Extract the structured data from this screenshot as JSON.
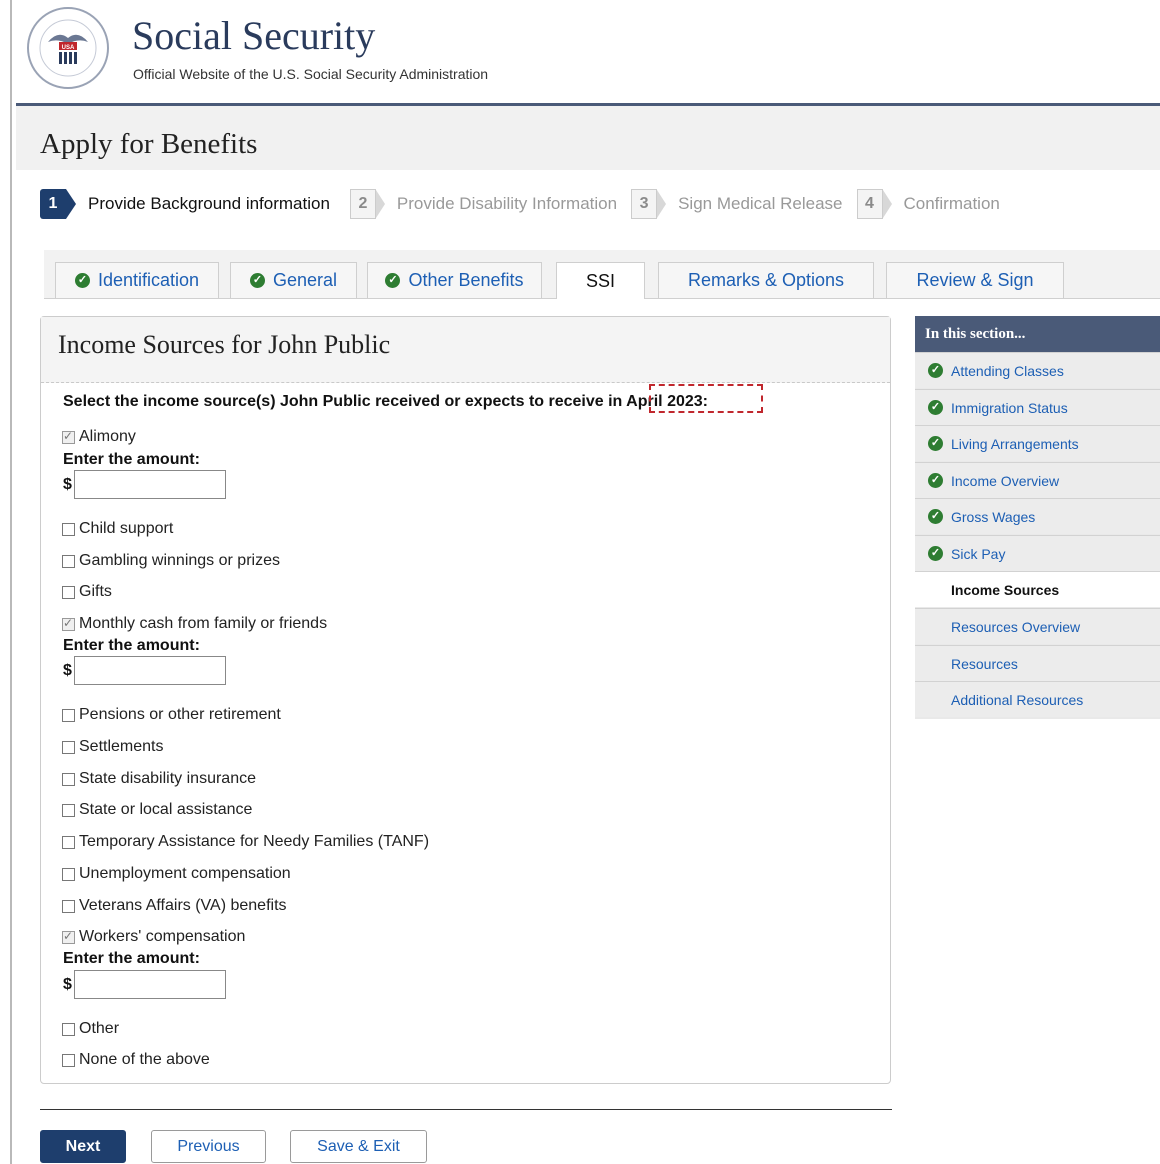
{
  "header": {
    "title": "Social Security",
    "subtitle": "Official Website of the U.S. Social Security Administration",
    "seal_text": "SOCIAL SECURITY ADMINISTRATION USA"
  },
  "page_title": "Apply for Benefits",
  "steps": [
    {
      "num": "1",
      "label": "Provide Background information",
      "active": true
    },
    {
      "num": "2",
      "label": "Provide Disability Information",
      "active": false
    },
    {
      "num": "3",
      "label": "Sign Medical Release",
      "active": false
    },
    {
      "num": "4",
      "label": "Confirmation",
      "active": false
    }
  ],
  "tabs": [
    {
      "label": "Identification",
      "completed": true
    },
    {
      "label": "General",
      "completed": true
    },
    {
      "label": "Other Benefits",
      "completed": true
    },
    {
      "label": "SSI",
      "active": true
    },
    {
      "label": "Remarks & Options"
    },
    {
      "label": "Review & Sign"
    }
  ],
  "form": {
    "title": "Income Sources for John Public",
    "question_main": "Select the income source(s) John Public received or expects to receive i",
    "question_highlight": "n April 2023:",
    "amount_label": "Enter the amount:",
    "currency": "$",
    "options": [
      {
        "label": "Alimony",
        "checked": true
      },
      {
        "label": "Child support",
        "checked": false
      },
      {
        "label": "Gambling winnings or prizes",
        "checked": false
      },
      {
        "label": "Gifts",
        "checked": false
      },
      {
        "label": "Monthly cash from family or friends",
        "checked": true
      },
      {
        "label": "Pensions or other retirement",
        "checked": false
      },
      {
        "label": "Settlements",
        "checked": false
      },
      {
        "label": "State disability insurance",
        "checked": false
      },
      {
        "label": "State or local assistance",
        "checked": false
      },
      {
        "label": "Temporary Assistance for Needy Families (TANF)",
        "checked": false
      },
      {
        "label": "Unemployment compensation",
        "checked": false
      },
      {
        "label": "Veterans Affairs (VA) benefits",
        "checked": false
      },
      {
        "label": "Workers' compensation",
        "checked": true
      },
      {
        "label": "Other",
        "checked": false
      },
      {
        "label": "None of the above",
        "checked": false
      }
    ]
  },
  "sidebar": {
    "heading": "In this section...",
    "items": [
      {
        "label": "Attending Classes",
        "done": true
      },
      {
        "label": "Immigration Status",
        "done": true
      },
      {
        "label": "Living Arrangements",
        "done": true
      },
      {
        "label": "Income Overview",
        "done": true
      },
      {
        "label": "Gross Wages",
        "done": true
      },
      {
        "label": "Sick Pay",
        "done": true
      },
      {
        "label": "Income Sources",
        "current": true
      },
      {
        "label": "Resources Overview"
      },
      {
        "label": "Resources"
      },
      {
        "label": "Additional Resources"
      }
    ]
  },
  "buttons": {
    "next": "Next",
    "previous": "Previous",
    "save_exit": "Save & Exit"
  },
  "colors": {
    "navy": "#1e3e6d",
    "link": "#1d5fb4",
    "check_green": "#2e7d32",
    "highlight_red": "#c0272d"
  }
}
